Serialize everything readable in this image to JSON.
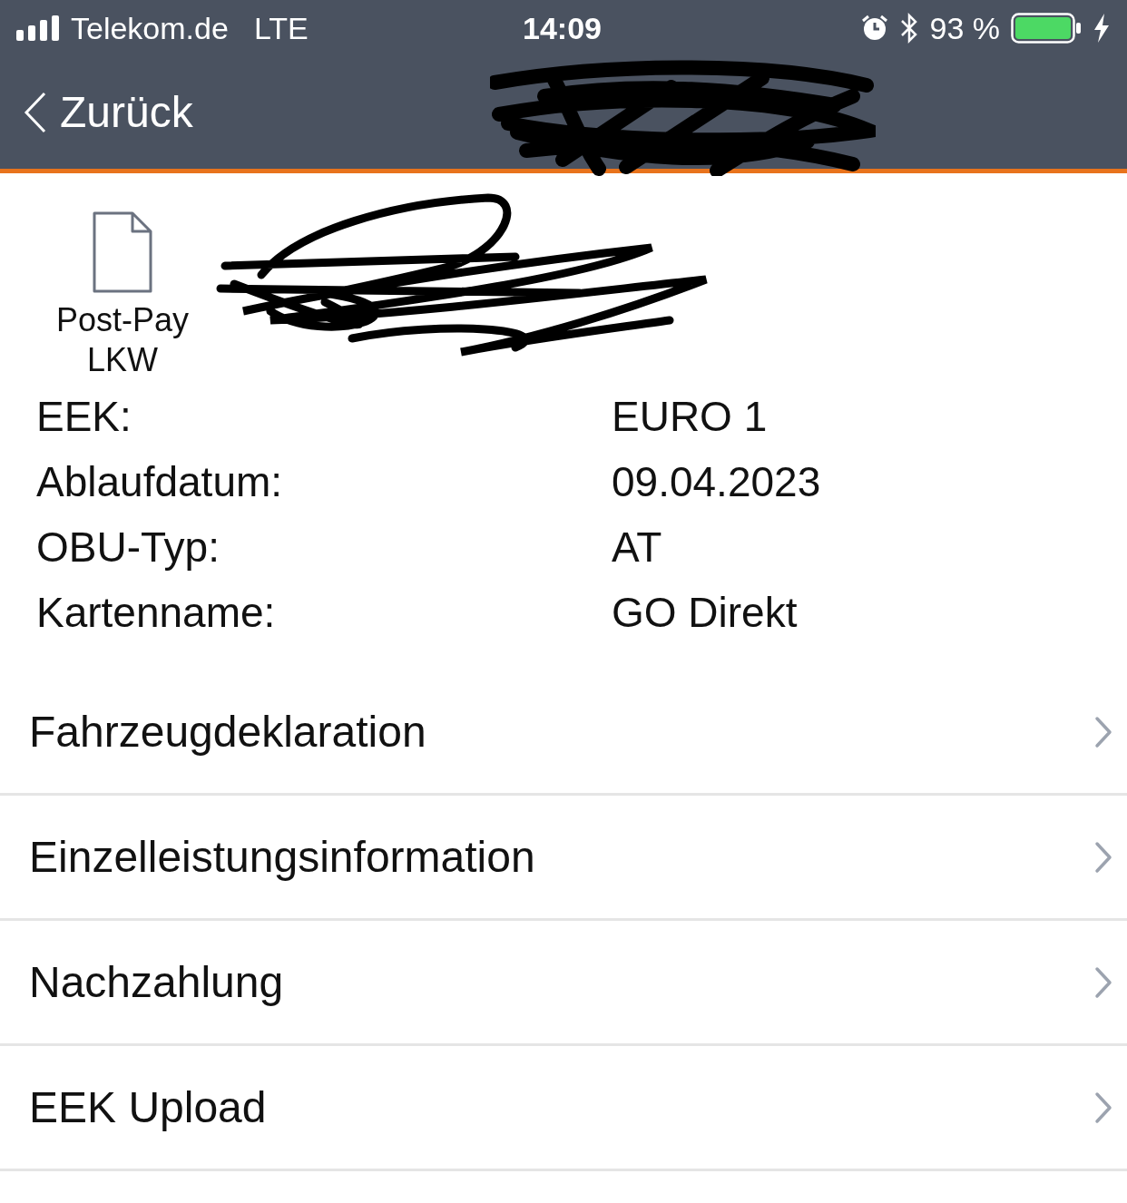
{
  "status_bar": {
    "carrier": "Telekom.de",
    "network": "LTE",
    "time": "14:09",
    "battery": "93 %"
  },
  "nav": {
    "back": "Zurück"
  },
  "card": {
    "type_label": "Post-Pay LKW"
  },
  "details": [
    {
      "label": "EEK:",
      "value": "EURO 1"
    },
    {
      "label": "Ablaufdatum:",
      "value": "09.04.2023"
    },
    {
      "label": "OBU-Typ:",
      "value": "AT"
    },
    {
      "label": "Kartenname:",
      "value": "GO Direkt"
    }
  ],
  "menu": [
    {
      "label": "Fahrzeugdeklaration"
    },
    {
      "label": "Einzelleistungsinformation"
    },
    {
      "label": "Nachzahlung"
    },
    {
      "label": "EEK Upload"
    }
  ]
}
